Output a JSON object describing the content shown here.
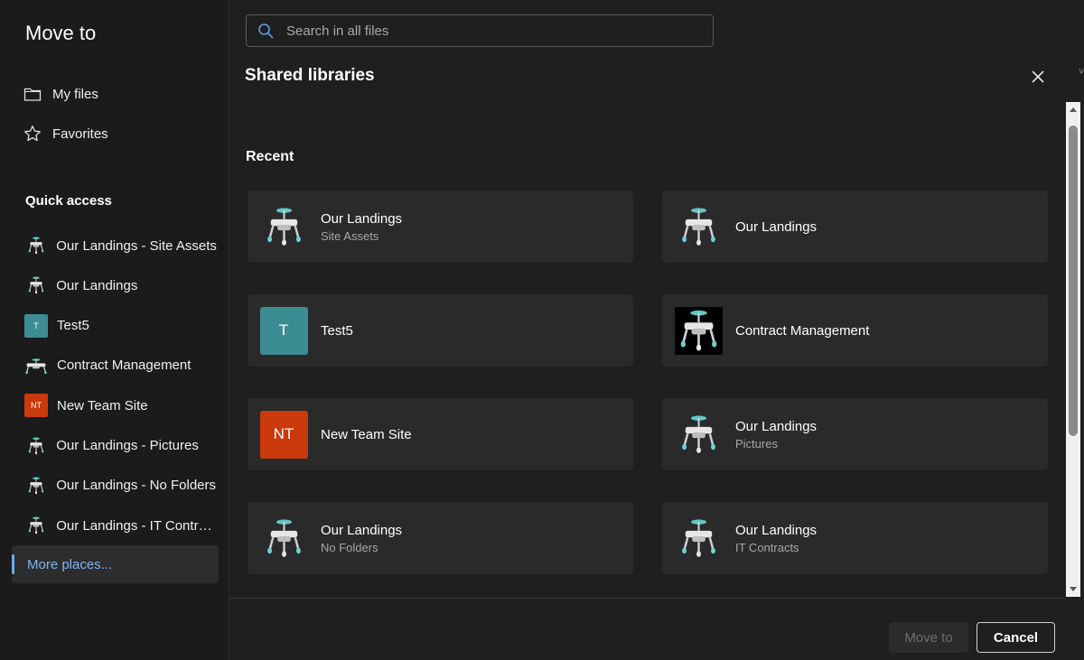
{
  "sidebar": {
    "title": "Move to",
    "nav": [
      {
        "label": "My files",
        "icon": "folder-icon"
      },
      {
        "label": "Favorites",
        "icon": "star-icon"
      }
    ],
    "section_title": "Quick access",
    "quick_access": [
      {
        "label": "Our Landings - Site Assets",
        "thumb": "drone"
      },
      {
        "label": "Our Landings",
        "thumb": "drone"
      },
      {
        "label": "Test5",
        "thumb": "T",
        "color": "#3c8c93"
      },
      {
        "label": "Contract Management",
        "thumb": "drone-wide"
      },
      {
        "label": "New Team Site",
        "thumb": "NT",
        "color": "#ca3a0d"
      },
      {
        "label": "Our Landings - Pictures",
        "thumb": "drone"
      },
      {
        "label": "Our Landings - No Folders",
        "thumb": "drone"
      },
      {
        "label": "Our Landings - IT Contracts",
        "thumb": "drone"
      }
    ],
    "more_label": "More places..."
  },
  "search": {
    "placeholder": "Search in all files"
  },
  "panel": {
    "title": "Shared libraries",
    "recent_label": "Recent",
    "cards": [
      {
        "name": "Our Landings",
        "sub": "Site Assets",
        "thumb": "drone"
      },
      {
        "name": "Our Landings",
        "sub": "",
        "thumb": "drone"
      },
      {
        "name": "Test5",
        "sub": "",
        "thumb": "T",
        "color": "#3c8c93"
      },
      {
        "name": "Contract Management",
        "sub": "",
        "thumb": "drone-dark"
      },
      {
        "name": "New Team Site",
        "sub": "",
        "thumb": "NT",
        "color": "#ca3a0d"
      },
      {
        "name": "Our Landings",
        "sub": "Pictures",
        "thumb": "drone"
      },
      {
        "name": "Our Landings",
        "sub": "No Folders",
        "thumb": "drone"
      },
      {
        "name": "Our Landings",
        "sub": "IT Contracts",
        "thumb": "drone"
      }
    ]
  },
  "footer": {
    "move_label": "Move to",
    "cancel_label": "Cancel"
  }
}
